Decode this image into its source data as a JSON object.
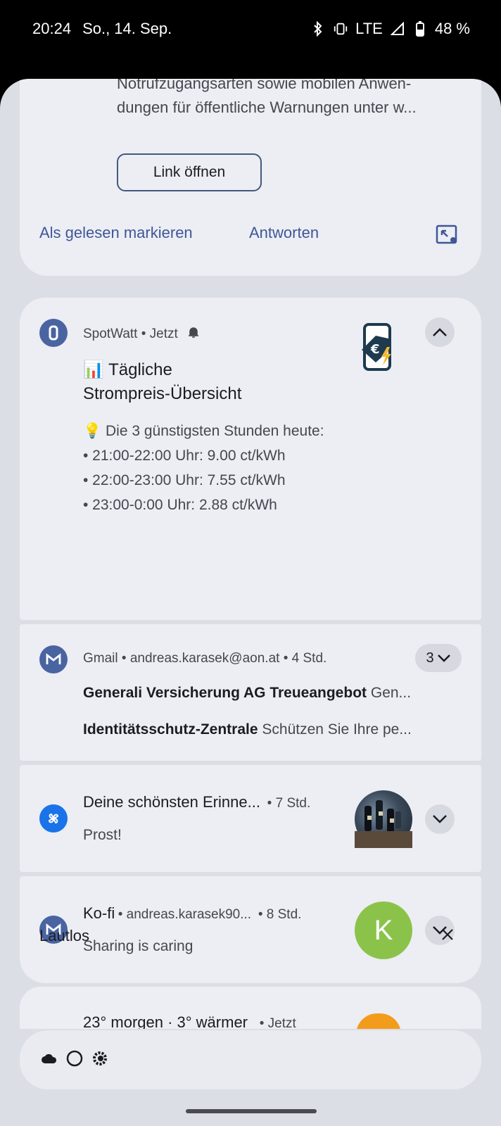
{
  "status_bar": {
    "time": "20:24",
    "date": "So., 14. Sep.",
    "network": "LTE",
    "battery": "48 %"
  },
  "top_card": {
    "text_line1": "Notrufzugangsarten sowie mobilen Anwen-",
    "text_line2": "dungen für öffentliche Warnungen unter w...",
    "link_button": "Link öffnen",
    "action_read": "Als gelesen markieren",
    "action_reply": "Antworten"
  },
  "spotwatt": {
    "app_name": "SpotWatt",
    "time": "Jetzt",
    "title_line1": "📊 Tägliche",
    "title_line2": "Strompreis-Übersicht",
    "lines": [
      "💡 Die 3 günstigsten Stunden heute:",
      "• 21:00-22:00 Uhr: 9.00 ct/kWh",
      "• 22:00-23:00 Uhr: 7.55 ct/kWh",
      "• 23:00-0:00 Uhr: 2.88 ct/kWh"
    ]
  },
  "gmail": {
    "app_name": "Gmail",
    "account": "andreas.karasek@aon.at",
    "time": "4 Std.",
    "count": "3",
    "messages": [
      {
        "subject": "Generali Versicherung AG Treueangebot",
        "preview": "Gen..."
      },
      {
        "subject": "Identitätsschutz-Zentrale",
        "preview": "Schützen Sie Ihre pe..."
      }
    ]
  },
  "memories": {
    "title": "Deine schönsten Erinne...",
    "time": "7 Std.",
    "text": "Prost!"
  },
  "kofi": {
    "title": "Ko-fi",
    "account": "andreas.karasek90...",
    "time": "8 Std.",
    "text": "Sharing is caring",
    "avatar_letter": "K"
  },
  "silent_section": {
    "label": "Lautlos"
  },
  "weather": {
    "text": "23° morgen · 3° wärmer",
    "time": "Jetzt"
  },
  "colors": {
    "accent": "#3f5796",
    "app_icon_blue": "#4a64a2",
    "memories_blue": "#1a73e8",
    "kofi_avatar": "#8bc34a"
  }
}
